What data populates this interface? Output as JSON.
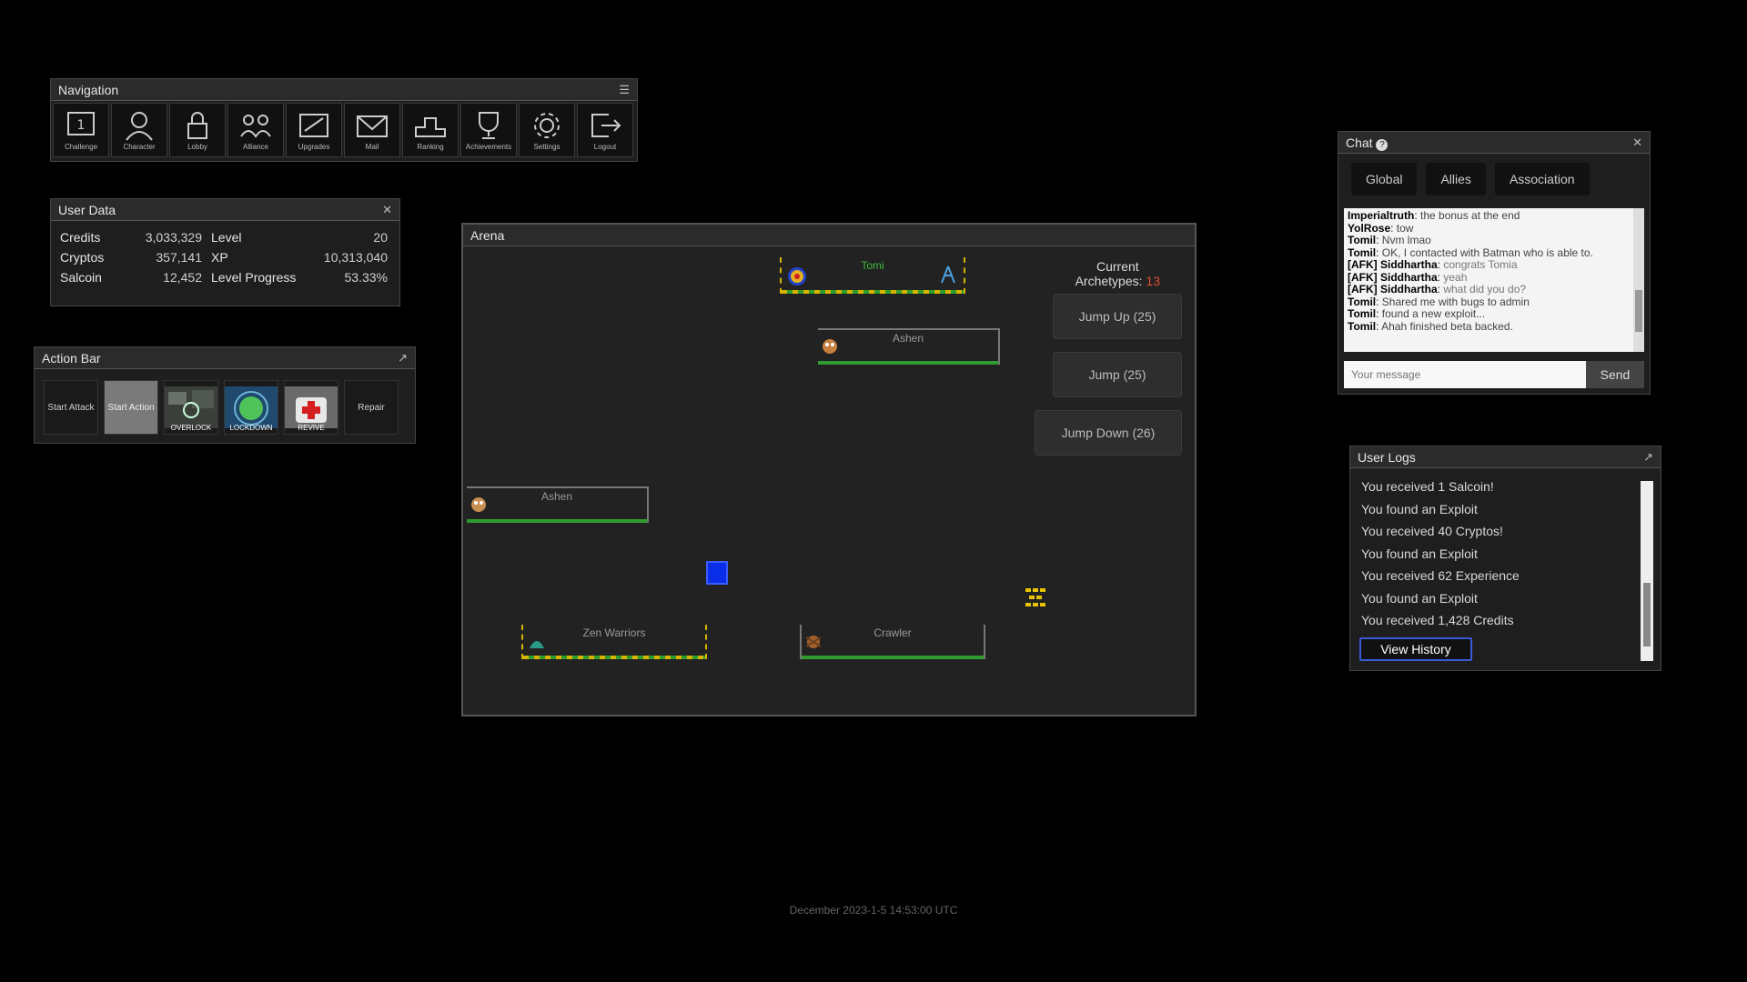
{
  "navigation": {
    "title": "Navigation",
    "items": [
      {
        "label": "Challenge",
        "icon": "challenge-icon"
      },
      {
        "label": "Character",
        "icon": "character-icon"
      },
      {
        "label": "Lobby",
        "icon": "lock-icon"
      },
      {
        "label": "Alliance",
        "icon": "alliance-icon"
      },
      {
        "label": "Upgrades",
        "icon": "upgrade-icon"
      },
      {
        "label": "Mail",
        "icon": "mail-icon"
      },
      {
        "label": "Ranking",
        "icon": "podium-icon"
      },
      {
        "label": "Achievements",
        "icon": "trophy-icon"
      },
      {
        "label": "Settings",
        "icon": "gear-icon"
      },
      {
        "label": "Logout",
        "icon": "logout-icon"
      }
    ]
  },
  "user_data": {
    "title": "User Data",
    "rows": [
      {
        "k1": "Credits",
        "v1": "3,033,329",
        "k2": "Level",
        "v2": "20"
      },
      {
        "k1": "Cryptos",
        "v1": "357,141",
        "k2": "XP",
        "v2": "10,313,040"
      },
      {
        "k1": "Salcoin",
        "v1": "12,452",
        "k2": "Level Progress",
        "v2": "53.33%"
      }
    ]
  },
  "action_bar": {
    "title": "Action Bar",
    "buttons": [
      {
        "label": "Start Attack",
        "active": false
      },
      {
        "label": "Start Action",
        "active": true
      },
      {
        "label": "OVERLOCK",
        "image": "overlock"
      },
      {
        "label": "LOCKDOWN",
        "image": "lockdown"
      },
      {
        "label": "REVIVE",
        "image": "medkit"
      },
      {
        "label": "Repair",
        "active": false
      }
    ]
  },
  "arena": {
    "title": "Arena",
    "status_line1": "Current",
    "status_line2": "Archetypes: ",
    "status_count": "13",
    "jump_buttons": [
      "Jump Up (25)",
      "Jump (25)",
      "Jump Down (26)"
    ],
    "platforms": [
      {
        "name": "Tomi",
        "style": "dashed",
        "name_color": "#3db83d"
      },
      {
        "name": "Ashen",
        "style": "wall"
      },
      {
        "name": "Ashen",
        "style": "wall"
      },
      {
        "name": "Zen Warriors",
        "style": "dashed"
      },
      {
        "name": "Crawler",
        "style": "wall"
      }
    ]
  },
  "chat": {
    "title": "Chat",
    "tabs": [
      "Global",
      "Allies",
      "Association"
    ],
    "messages": [
      {
        "user": "Imperialtruth",
        "text": "the bonus at the end",
        "sys": false
      },
      {
        "user": "YolRose",
        "text": "tow",
        "sys": false
      },
      {
        "user": "Tomil",
        "text": "Nvm lmao",
        "sys": false
      },
      {
        "user": "Tomil",
        "text": "OK, I contacted with Batman who is able to.",
        "sys": false
      },
      {
        "user": "[AFK] Siddhartha",
        "text": "congrats Tomia",
        "sys": true
      },
      {
        "user": "[AFK] Siddhartha",
        "text": "yeah",
        "sys": true
      },
      {
        "user": "[AFK] Siddhartha",
        "text": "what did you do?",
        "sys": true
      },
      {
        "user": "Tomil",
        "text": "Shared me with bugs to admin",
        "sys": false
      },
      {
        "user": "Tomil",
        "text": "found a new exploit...",
        "sys": false
      },
      {
        "user": "Tomil",
        "text": "Ahah finished beta backed.",
        "sys": false
      }
    ],
    "input_placeholder": "Your message",
    "send_label": "Send"
  },
  "logs": {
    "title": "User Logs",
    "entries": [
      "You received 1 Salcoin!",
      "You found an Exploit",
      "You received 40 Cryptos!",
      "You found an Exploit",
      "You received 62 Experience",
      "You found an Exploit",
      "You received 1,428 Credits"
    ],
    "view_history": "View History"
  },
  "footer": "December 2023-1-5 14:53:00 UTC",
  "colors": {
    "accent_blue": "#0a2ee8",
    "platform_green": "#2e9c2e",
    "dashed_yellow": "#d6b400",
    "counter_red": "#e05030"
  }
}
